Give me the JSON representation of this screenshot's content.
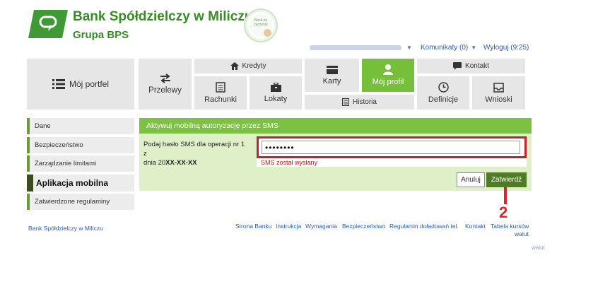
{
  "header": {
    "bank_name": "Bank Spółdzielczy w Miliczu",
    "group_name": "Grupa BPS",
    "seal_text": "Bank na życzenie",
    "messages_link": "Komunikaty (0)",
    "logout_link": "Wyloguj (9:25)"
  },
  "nav": {
    "portfel": "Mój portfel",
    "przelewy": "Przelewy",
    "kredyty": "Kredyty",
    "rachunki": "Rachunki",
    "lokaty": "Lokaty",
    "karty": "Karty",
    "historia": "Historia",
    "profil": "Mój profil",
    "kontakt": "Kontakt",
    "definicje": "Definicje",
    "wnioski": "Wnioski"
  },
  "sidebar": {
    "items": [
      {
        "label": "Dane"
      },
      {
        "label": "Bezpieczeństwo"
      },
      {
        "label": "Zarządzanie limitami"
      },
      {
        "label": "Aplikacja mobilna"
      },
      {
        "label": "Zatwierdzone regulaminy"
      }
    ]
  },
  "panel": {
    "title": "Aktywuj mobilną autoryzację przez SMS",
    "label_line1": "Podaj hasło SMS dla operacji nr 1 z",
    "label_line2_prefix": "dnia 20",
    "label_line2_date": "XX-XX-XX",
    "password_value": "••••••••",
    "sms_status": "SMS został wysłany",
    "cancel_label": "Anuluj",
    "confirm_label": "Zatwierdź"
  },
  "annotation": {
    "step_number": "2"
  },
  "footer": {
    "bank_name": "Bank Spółdzielczy w Miliczu",
    "links": [
      "Strona Banku",
      "Instrukcja",
      "Wymagania",
      "Bezpieczeństwo",
      "Regulamin doładowań tel.",
      "Kontakt",
      "Tabela kursów"
    ],
    "links_wrap": "walut",
    "ghost_text": "walut"
  },
  "colors": {
    "brand_green": "#3a8a2a",
    "active_tile": "#76bf3a",
    "panel_header": "#7cc142",
    "panel_body": "#dff0c8",
    "confirm_button": "#4f7a26",
    "highlight_red": "#c9202a"
  }
}
